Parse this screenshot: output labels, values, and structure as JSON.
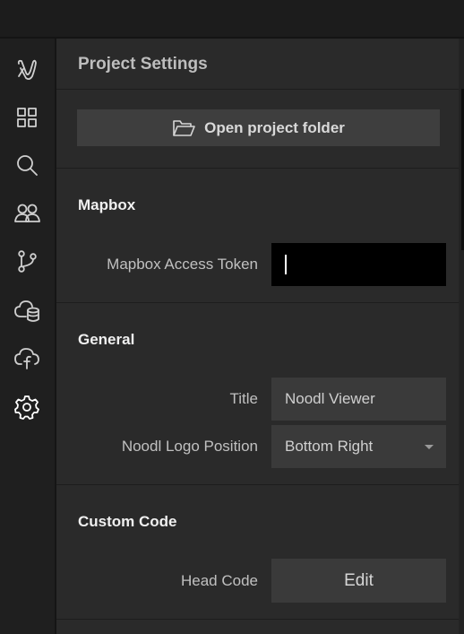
{
  "panel": {
    "title": "Project Settings"
  },
  "actions": {
    "open_folder_label": "Open project folder"
  },
  "sidebar": {
    "icons": [
      "noodl-logo-icon",
      "components-grid-icon",
      "search-icon",
      "users-icon",
      "branch-icon",
      "cloud-database-icon",
      "cloud-function-icon",
      "settings-gear-icon"
    ],
    "active": "settings-gear-icon"
  },
  "mapbox": {
    "heading": "Mapbox",
    "token_label": "Mapbox Access Token",
    "token_value": ""
  },
  "general": {
    "heading": "General",
    "title_label": "Title",
    "title_value": "Noodl Viewer",
    "logo_label": "Noodl Logo Position",
    "logo_value": "Bottom Right"
  },
  "custom_code": {
    "heading": "Custom Code",
    "head_label": "Head Code",
    "edit_label": "Edit"
  },
  "colors": {
    "background": "#2a2a2a",
    "rail": "#1f1f1f",
    "field": "#3a3a3a",
    "token_field": "#000000"
  }
}
